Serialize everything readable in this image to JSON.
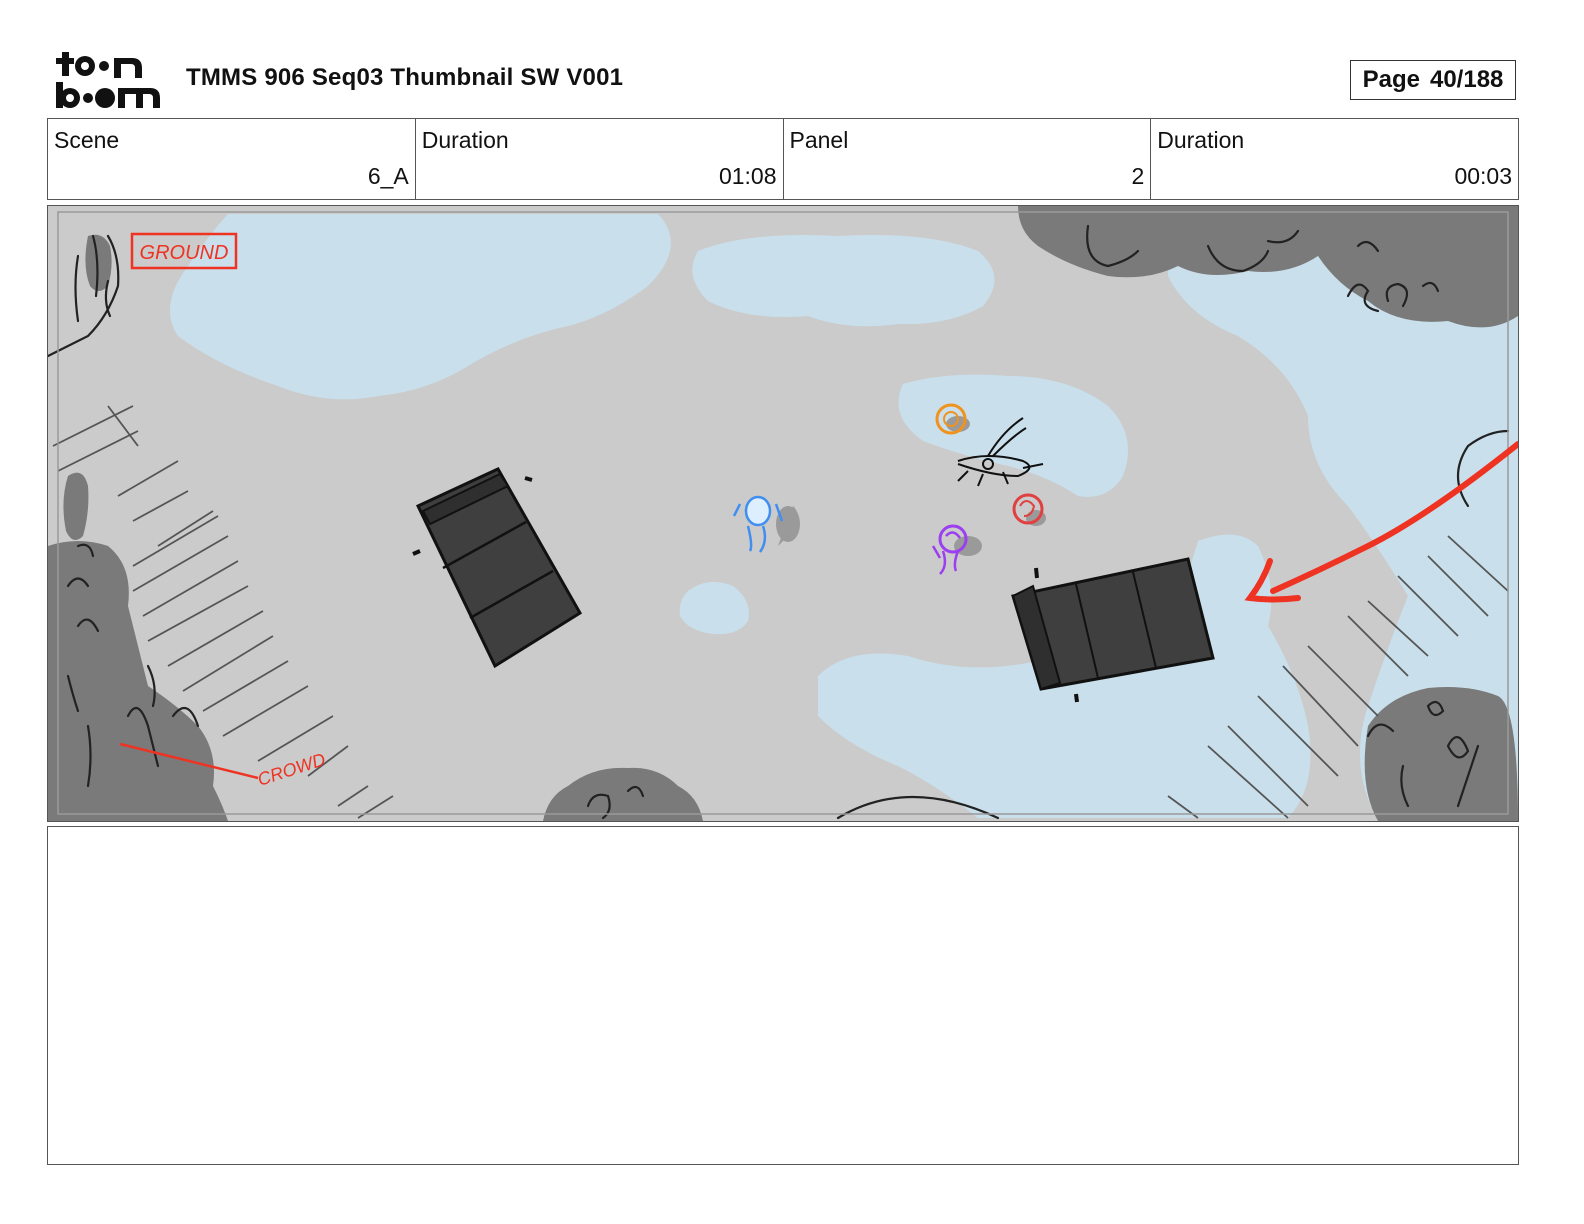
{
  "header": {
    "title": "TMMS 906 Seq03 Thumbnail SW V001",
    "page_label": "Page",
    "page_value": "40/188"
  },
  "info": {
    "scene_label": "Scene",
    "scene_value": "6_A",
    "scene_duration_label": "Duration",
    "scene_duration_value": "01:08",
    "panel_label": "Panel",
    "panel_value": "2",
    "panel_duration_label": "Duration",
    "panel_duration_value": "00:03"
  },
  "drawing": {
    "ground_label": "GROUND",
    "crowd_label": "CROWD",
    "colors": {
      "ground": "#cbcbcb",
      "water": "#c9e0ec",
      "bush": "#7a7a7a",
      "truck": "#3f3f3f",
      "accent_red": "#ee3322",
      "char_orange": "#f0921e",
      "char_blue": "#3f8ef0",
      "char_red": "#e04040",
      "char_purple": "#9b3ff0"
    }
  },
  "notes": {}
}
